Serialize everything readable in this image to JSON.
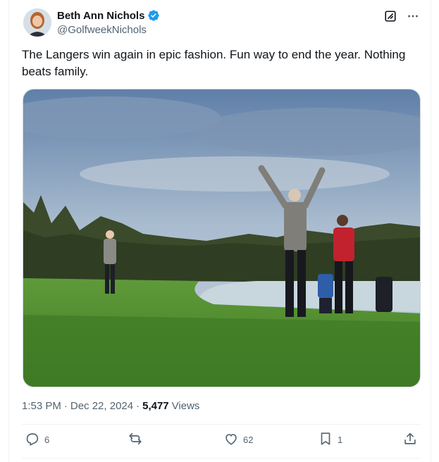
{
  "author": {
    "display_name": "Beth Ann Nichols",
    "handle": "@GolfweekNichols"
  },
  "tweet": {
    "text": "The Langers win again in epic fashion. Fun way to end the year. Nothing beats family.",
    "time": "1:53 PM",
    "date": "Dec 22, 2024",
    "views_count": "5,477",
    "views_label": "Views"
  },
  "actions": {
    "replies": "6",
    "likes": "62",
    "bookmarks": "1"
  },
  "colors": {
    "verified": "#1d9bf0",
    "text_primary": "#0f1419",
    "text_secondary": "#536471"
  },
  "icons": {
    "verified": "verified-badge-icon",
    "grok": "grok-icon",
    "more": "more-icon",
    "reply": "reply-icon",
    "retweet": "retweet-icon",
    "like": "heart-icon",
    "bookmark": "bookmark-icon",
    "share": "share-icon"
  }
}
